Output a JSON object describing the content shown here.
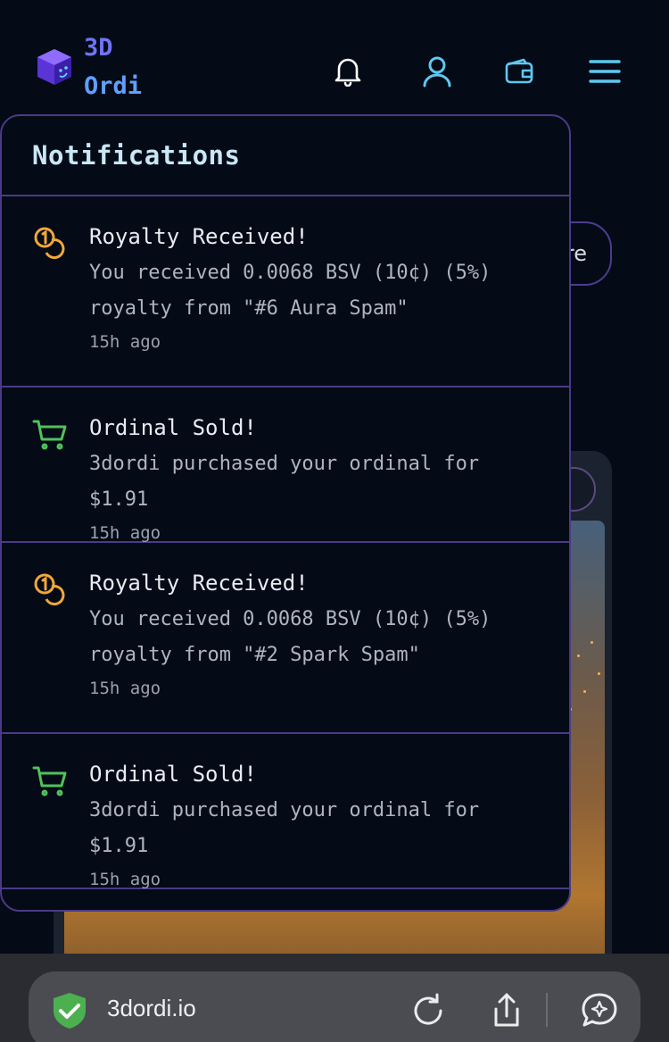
{
  "header": {
    "logo_line1": "3D",
    "logo_line2": "Ordi",
    "icons": [
      "bell-icon",
      "user-icon",
      "wallet-icon",
      "menu-icon"
    ]
  },
  "background": {
    "pill_text": "re"
  },
  "notifications": {
    "title": "Notifications",
    "items": [
      {
        "icon": "coins-icon",
        "title": "Royalty Received!",
        "body": "You received 0.0068 BSV (10¢) (5%) royalty from \"#6 Aura Spam\"",
        "time": "15h ago"
      },
      {
        "icon": "cart-icon",
        "title": "Ordinal Sold!",
        "body": "3dordi purchased your ordinal for $1.91",
        "time": "15h ago"
      },
      {
        "icon": "coins-icon",
        "title": "Royalty Received!",
        "body": "You received 0.0068 BSV (10¢) (5%) royalty from \"#2 Spark Spam\"",
        "time": "15h ago"
      },
      {
        "icon": "cart-icon",
        "title": "Ordinal Sold!",
        "body": "3dordi purchased your ordinal for $1.91",
        "time": "15h ago"
      }
    ]
  },
  "browser": {
    "url": "3dordi.io",
    "icons": [
      "shield-check-icon",
      "reload-icon",
      "share-icon",
      "assistant-icon"
    ]
  },
  "colors": {
    "background": "#050a17",
    "border": "#4a3a86",
    "coin": "#f0a83a",
    "cart": "#4fc25a",
    "header_icon": "#5fc7f0"
  }
}
